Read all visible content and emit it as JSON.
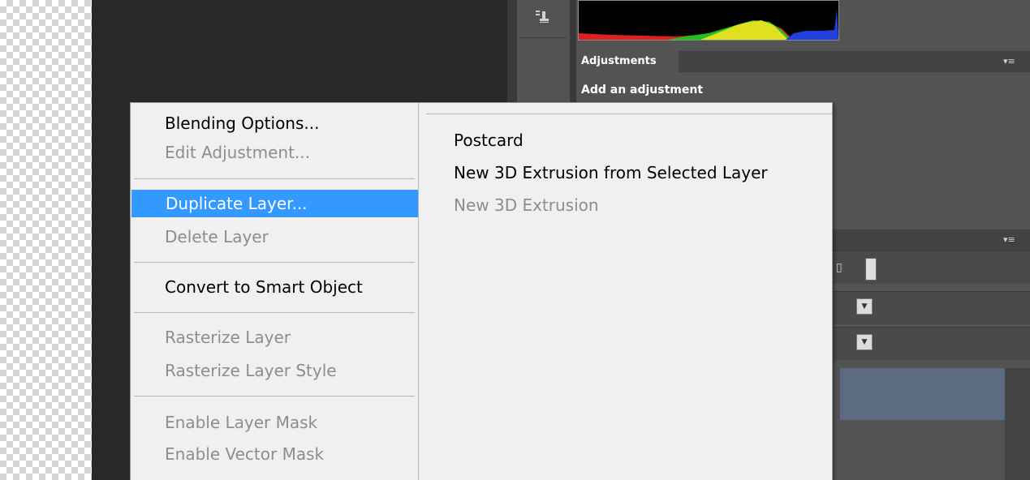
{
  "panels": {
    "adjustments_tab": "Adjustments",
    "adjustments_title": "Add an adjustment"
  },
  "context_menu": {
    "left_items": [
      {
        "label": "Blending Options...",
        "disabled": false
      },
      {
        "label": "Edit Adjustment...",
        "disabled": true
      },
      {
        "label": "Duplicate Layer...",
        "disabled": false,
        "highlighted": true
      },
      {
        "label": "Delete Layer",
        "disabled": true
      },
      {
        "label": "Convert to Smart Object",
        "disabled": false
      },
      {
        "label": "Rasterize Layer",
        "disabled": true
      },
      {
        "label": "Rasterize Layer Style",
        "disabled": true
      },
      {
        "label": "Enable Layer Mask",
        "disabled": true
      },
      {
        "label": "Enable Vector Mask",
        "disabled": true
      }
    ],
    "right_items": [
      {
        "label": "Postcard",
        "disabled": false
      },
      {
        "label": "New 3D Extrusion from Selected Layer",
        "disabled": false
      },
      {
        "label": "New 3D Extrusion",
        "disabled": true
      }
    ]
  },
  "colors": {
    "highlight": "#3399ff",
    "disabled_text": "#8d8d8d",
    "panel_bg": "#535353",
    "canvas_bg": "#282828"
  },
  "icons": {
    "tool": "stamp-icon",
    "panel_menu": "panel-menu-icon",
    "dropdown": "dropdown-arrow-icon",
    "lock": "lock-icon"
  }
}
